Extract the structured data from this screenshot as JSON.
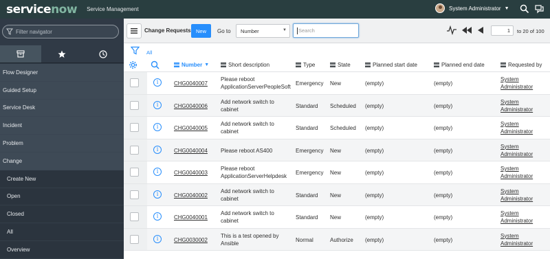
{
  "banner": {
    "logo_service": "service",
    "logo_now": "now",
    "app_name": "Service Management",
    "user_name": "System Administrator",
    "icons": [
      "search-icon",
      "chat-icon"
    ]
  },
  "nav": {
    "filter_placeholder": "Filter navigator",
    "tabs": [
      "archive-icon",
      "star-icon",
      "clock-icon"
    ],
    "items": [
      {
        "label": "Flow Designer",
        "sub": false
      },
      {
        "label": "Guided Setup",
        "sub": false
      },
      {
        "label": "Service Desk",
        "sub": false
      },
      {
        "label": "Incident",
        "sub": false
      },
      {
        "label": "Problem",
        "sub": false
      },
      {
        "label": "Change",
        "sub": false
      },
      {
        "label": "Create New",
        "sub": true
      },
      {
        "label": "Open",
        "sub": true
      },
      {
        "label": "Closed",
        "sub": true
      },
      {
        "label": "All",
        "sub": true
      },
      {
        "label": "Overview",
        "sub": true
      }
    ]
  },
  "list": {
    "title": "Change Requests",
    "new_label": "New",
    "goto_label": "Go to",
    "goto_value": "Number",
    "search_placeholder": "Search",
    "page_value": "1",
    "page_of": "to 20 of 100",
    "breadcrumb_all": "All",
    "accent": "#278efc"
  },
  "columns": {
    "number": "Number",
    "desc": "Short description",
    "type": "Type",
    "state": "State",
    "start": "Planned start date",
    "end": "Planned end date",
    "req": "Requested by"
  },
  "rows": [
    {
      "number": "CHG0040007",
      "desc": "Please reboot ApplicationServerPeopleSoft",
      "type": "Emergency",
      "state": "New",
      "start": "(empty)",
      "end": "(empty)",
      "req": "System Administrator"
    },
    {
      "number": "CHG0040006",
      "desc": "Add network switch to cabinet",
      "type": "Standard",
      "state": "Scheduled",
      "start": "(empty)",
      "end": "(empty)",
      "req": "System Administrator"
    },
    {
      "number": "CHG0040005",
      "desc": "Add network switch to cabinet",
      "type": "Standard",
      "state": "Scheduled",
      "start": "(empty)",
      "end": "(empty)",
      "req": "System Administrator"
    },
    {
      "number": "CHG0040004",
      "desc": "Please reboot AS400",
      "type": "Emergency",
      "state": "New",
      "start": "(empty)",
      "end": "(empty)",
      "req": "System Administrator"
    },
    {
      "number": "CHG0040003",
      "desc": "Please reboot ApplicationServerHelpdesk",
      "type": "Emergency",
      "state": "New",
      "start": "(empty)",
      "end": "(empty)",
      "req": "System Administrator"
    },
    {
      "number": "CHG0040002",
      "desc": "Add network switch to cabinet",
      "type": "Standard",
      "state": "New",
      "start": "(empty)",
      "end": "(empty)",
      "req": "System Administrator"
    },
    {
      "number": "CHG0040001",
      "desc": "Add network switch to cabinet",
      "type": "Standard",
      "state": "New",
      "start": "(empty)",
      "end": "(empty)",
      "req": "System Administrator"
    },
    {
      "number": "CHG0030002",
      "desc": "This is a test opened by Ansible",
      "type": "Normal",
      "state": "Authorize",
      "start": "(empty)",
      "end": "(empty)",
      "req": "System Administrator"
    }
  ]
}
